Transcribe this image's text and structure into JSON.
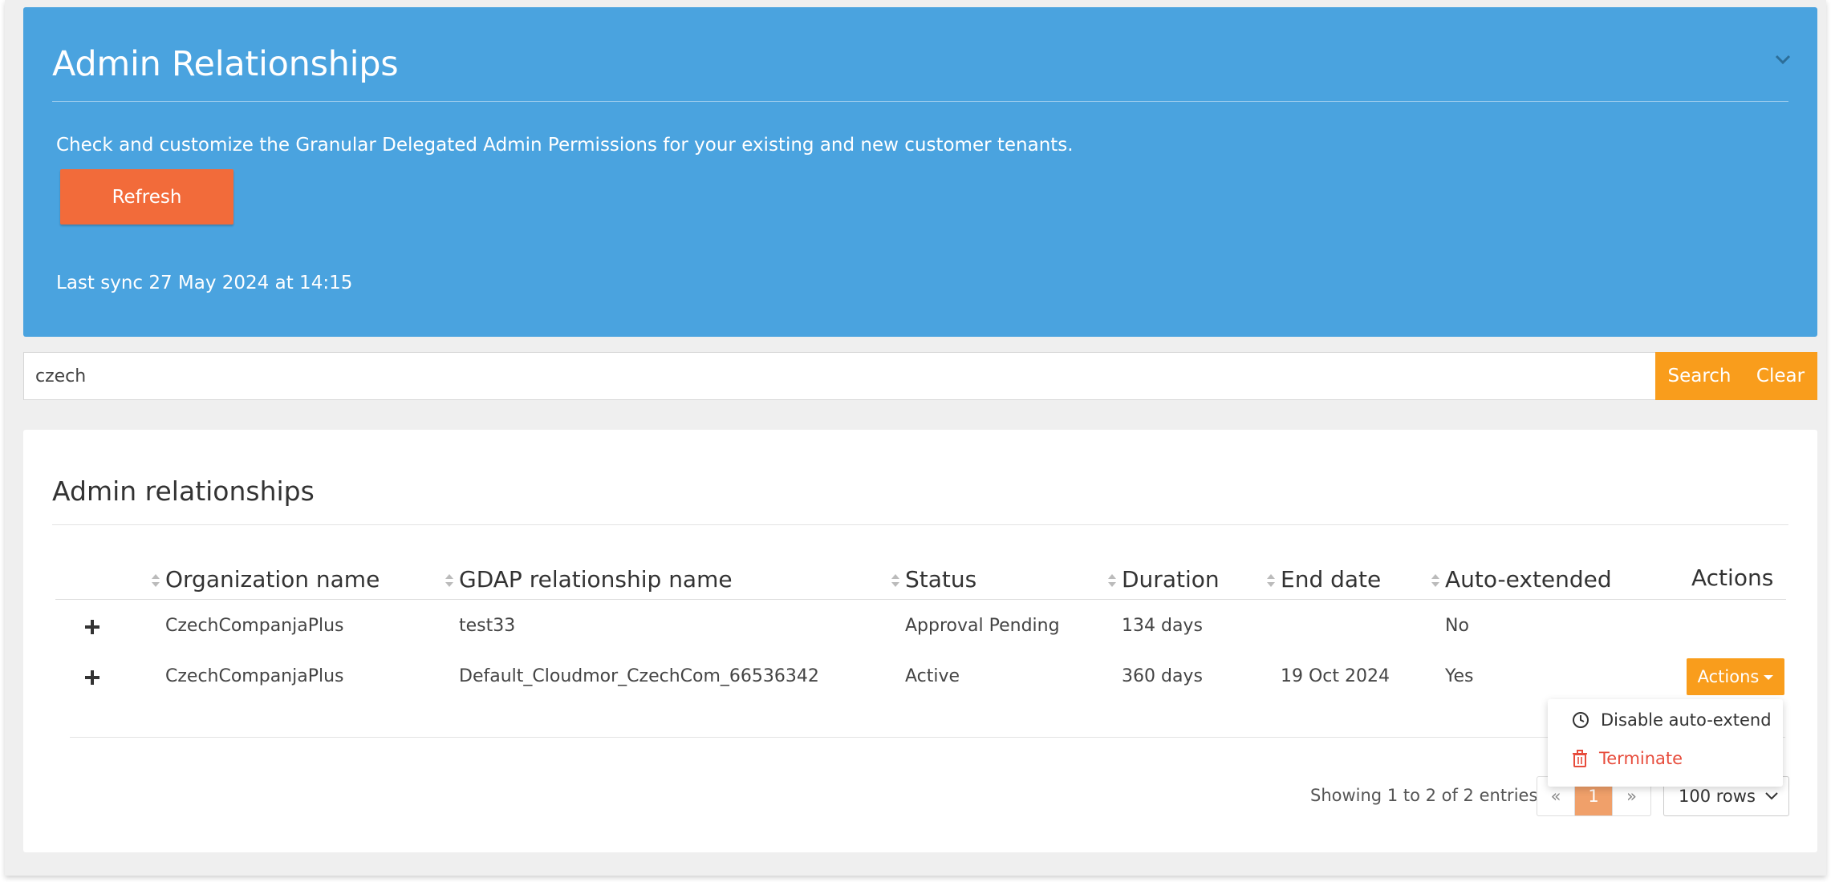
{
  "header": {
    "title": "Admin Relationships",
    "description": "Check and customize the Granular Delegated Admin Permissions for your existing and new customer tenants.",
    "refresh_label": "Refresh",
    "last_sync": "Last sync 27 May 2024 at 14:15"
  },
  "search": {
    "value": "czech",
    "search_label": "Search",
    "clear_label": "Clear"
  },
  "table": {
    "title": "Admin relationships",
    "columns": [
      "Organization name",
      "GDAP relationship name",
      "Status",
      "Duration",
      "End date",
      "Auto-extended",
      "Actions"
    ],
    "rows": [
      {
        "org": "CzechCompanjaPlus",
        "gdap": "test33",
        "status": "Approval Pending",
        "duration": "134 days",
        "end_date": "",
        "auto_extended": "No"
      },
      {
        "org": "CzechCompanjaPlus",
        "gdap": "Default_Cloudmor_CzechCom_66536342",
        "status": "Active",
        "duration": "360 days",
        "end_date": "19 Oct 2024",
        "auto_extended": "Yes"
      }
    ],
    "row_actions_label": "Actions"
  },
  "actions_menu": {
    "items": [
      {
        "label": "Disable auto-extend",
        "icon": "clock-icon"
      },
      {
        "label": "Terminate",
        "icon": "trash-icon"
      }
    ]
  },
  "pagination": {
    "showing": "Showing 1 to 2 of 2 entries",
    "prev": "«",
    "current": "1",
    "next": "»",
    "rows_per_page": "100 rows"
  },
  "colors": {
    "hero": "#4aa3df",
    "refresh": "#f26b3a",
    "accent": "#f99d1c",
    "danger": "#e74c3c"
  }
}
